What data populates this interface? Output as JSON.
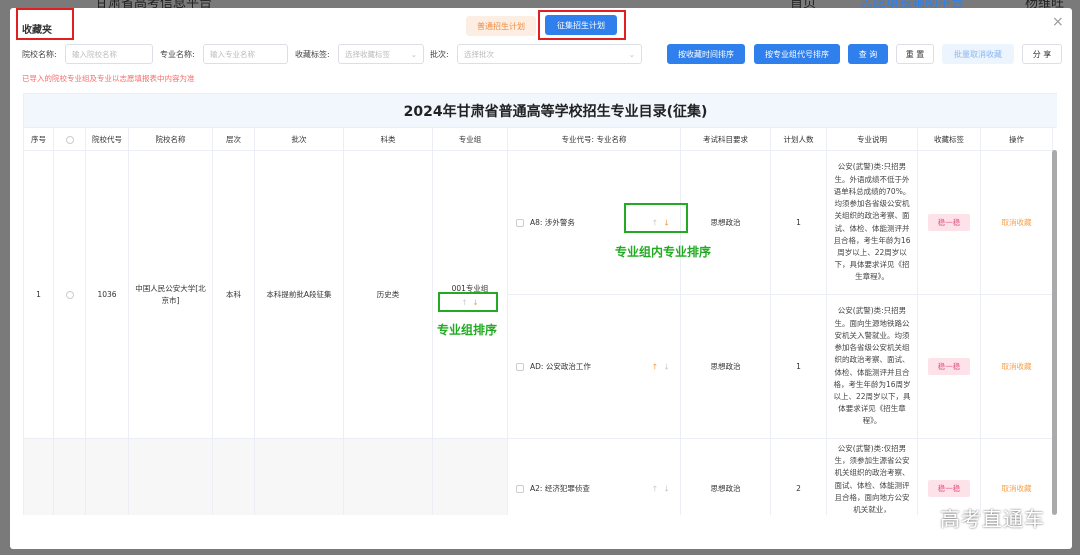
{
  "background": {
    "site_title": "甘肃省高考信息平台",
    "nav_home": "首页",
    "nav_assist": "志愿填报辅助平台",
    "user": "杨维旺"
  },
  "modal": {
    "title": "收藏夹",
    "tab_normal": "普通招生计划",
    "tab_collect": "征集招生计划",
    "close": "×"
  },
  "filters": {
    "school_label": "院校名称:",
    "school_placeholder": "输入院校名称",
    "major_label": "专业名称:",
    "major_placeholder": "输入专业名称",
    "tag_label": "收藏标签:",
    "tag_placeholder": "选择收藏标签",
    "batch_label": "批次:",
    "batch_placeholder": "选择批次"
  },
  "buttons": {
    "sort_time": "按收藏时间排序",
    "sort_group": "按专业组代号排序",
    "query": "查 询",
    "reset": "重 置",
    "batch_cancel": "批量取消收藏",
    "share": "分 享"
  },
  "notice": "已导入的院校专业组及专业以志愿填报表中内容为准",
  "table": {
    "title": "2024年甘肃省普通高等学校招生专业目录(征集)",
    "headers": [
      "序号",
      "",
      "院校代号",
      "院校名称",
      "层次",
      "批次",
      "科类",
      "专业组",
      "专业代号: 专业名称",
      "考试科目要求",
      "计划人数",
      "专业说明",
      "收藏标签",
      "操作"
    ],
    "school": {
      "index": "1",
      "code": "1036",
      "name": "中国人民公安大学[北京市]",
      "level": "本科",
      "batch": "本科提前批A段征集",
      "category": "历史类",
      "group": "001专业组"
    },
    "rows": [
      {
        "major": "A8: 涉外警务",
        "subject": "思想政治",
        "plan": "1",
        "desc": "公安(武警)类:只招男生。外语成绩不低于外语单科总成绩的70%。均须参加各省级公安机关组织的政治考察、面试、体检、体能测评并且合格，考生年龄为16周岁以上、22周岁以下，具体要求详见《招生章程》。",
        "tag": "稳一稳",
        "action": "取消收藏"
      },
      {
        "major": "AD: 公安政治工作",
        "subject": "思想政治",
        "plan": "1",
        "desc": "公安(武警)类:只招男生。面向生源地铁路公安机关入警就业。均须参加各省级公安机关组织的政治考察、面试、体检、体能测评并且合格，考生年龄为16周岁以上、22周岁以下，具体要求详见《招生章程》。",
        "tag": "稳一稳",
        "action": "取消收藏"
      },
      {
        "major": "A2: 经济犯罪侦查",
        "subject": "思想政治",
        "plan": "2",
        "desc": "公安(武警)类:仅招男生，须参加生源省公安机关组织的政治考察、面试、体检、体能测评且合格，面向地方公安机关就业，",
        "tag": "稳一稳",
        "action": "取消收藏"
      }
    ]
  },
  "annotations": {
    "inner_sort": "专业组内专业排序",
    "group_sort": "专业组排序"
  },
  "watermark": "高考直通车"
}
